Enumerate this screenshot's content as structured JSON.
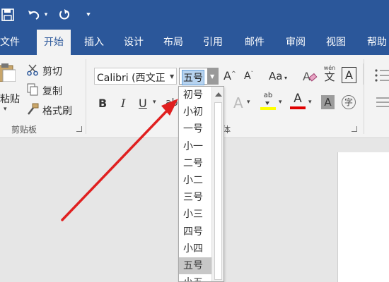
{
  "tabs": [
    {
      "label": "文件"
    },
    {
      "label": "开始"
    },
    {
      "label": "插入"
    },
    {
      "label": "设计"
    },
    {
      "label": "布局"
    },
    {
      "label": "引用"
    },
    {
      "label": "邮件"
    },
    {
      "label": "审阅"
    },
    {
      "label": "视图"
    },
    {
      "label": "帮助"
    }
  ],
  "active_tab": "开始",
  "clipboard": {
    "paste_label": "粘贴",
    "cut_label": "剪切",
    "copy_label": "复制",
    "format_painter_label": "格式刷",
    "group_label": "剪贴板"
  },
  "font": {
    "font_name": "Calibri (西文正",
    "font_size": "五号",
    "group_label_partial": "体",
    "pinyin_glyph": "wén",
    "pinyin_char": "文",
    "border_char": "A",
    "circle_char": "字"
  },
  "size_dropdown": {
    "items": [
      "初号",
      "小初",
      "一号",
      "小一",
      "二号",
      "小二",
      "三号",
      "小三",
      "四号",
      "小四",
      "五号",
      "小五"
    ],
    "selected": "五号"
  },
  "colors": {
    "ribbon_blue": "#2b579a",
    "annotation_arrow": "#e02020",
    "highlight": "#ffff00",
    "font_color": "#e00000"
  },
  "icons": [
    "save-icon",
    "undo-icon",
    "redo-icon",
    "customize-qat-icon",
    "scissors-icon",
    "copy-icon",
    "format-painter-icon",
    "bold-icon",
    "italic-icon",
    "underline-icon",
    "grow-font-icon",
    "shrink-font-icon",
    "change-case-icon",
    "clear-format-icon",
    "phonetic-guide-icon",
    "char-border-icon",
    "text-effects-icon",
    "highlight-icon",
    "font-color-icon",
    "char-shading-icon",
    "enclose-char-icon",
    "bullets-icon",
    "align-icon"
  ]
}
